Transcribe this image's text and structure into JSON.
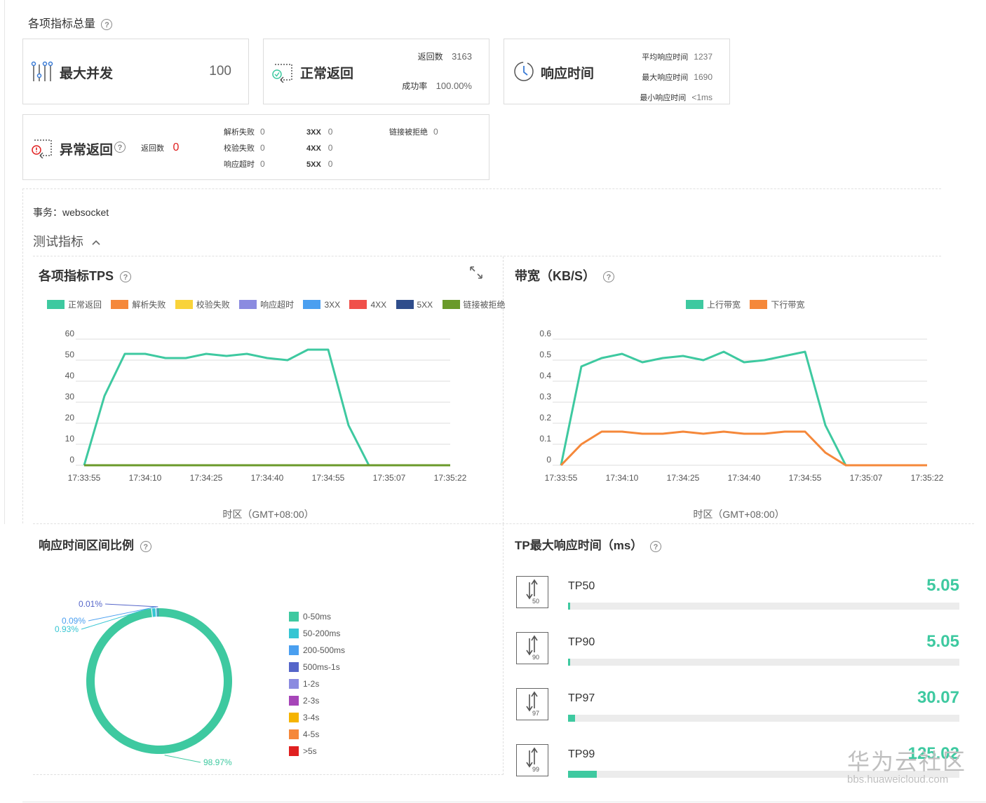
{
  "summary": {
    "title": "各项指标总量",
    "max_concurrency": {
      "title": "最大并发",
      "value": "100"
    },
    "normal_return": {
      "title": "正常返回",
      "return_count_label": "返回数",
      "return_count": "3163",
      "success_label": "成功率",
      "success_rate": "100.00%"
    },
    "response_time": {
      "title": "响应时间",
      "avg_label": "平均响应时间",
      "avg": "1237",
      "max_label": "最大响应时间",
      "max": "1690",
      "min_label": "最小响应时间",
      "min": "<1ms"
    },
    "abnormal_return": {
      "title": "异常返回",
      "return_count_label": "返回数",
      "return_count": "0",
      "parse_fail_label": "解析失败",
      "parse_fail": "0",
      "verify_fail_label": "校验失败",
      "verify_fail": "0",
      "timeout_label": "响应超时",
      "timeout": "0",
      "x3_label": "3XX",
      "x3": "0",
      "x4_label": "4XX",
      "x4": "0",
      "x5_label": "5XX",
      "x5": "0",
      "refused_label": "链接被拒绝",
      "refused": "0"
    }
  },
  "transaction": {
    "label": "事务：websocket"
  },
  "metrics_toggle": {
    "label": "测试指标"
  },
  "colors": {
    "accent": "#3ec9a0",
    "orange": "#f5883a",
    "error": "#e02020"
  },
  "tps_chart": {
    "title": "各项指标TPS",
    "timezone": "时区（GMT+08:00）",
    "legend": [
      {
        "name": "正常返回",
        "color": "#3ec9a0"
      },
      {
        "name": "解析失败",
        "color": "#f5883a"
      },
      {
        "name": "校验失败",
        "color": "#f9d33a"
      },
      {
        "name": "响应超时",
        "color": "#8b8be0"
      },
      {
        "name": "3XX",
        "color": "#4a9ff0"
      },
      {
        "name": "4XX",
        "color": "#f0504a"
      },
      {
        "name": "5XX",
        "color": "#2f4d8c"
      },
      {
        "name": "链接被拒绝",
        "color": "#6a9a2a"
      }
    ]
  },
  "bw_chart": {
    "title": "带宽（KB/S）",
    "timezone": "时区（GMT+08:00）",
    "legend": [
      {
        "name": "上行带宽",
        "color": "#3ec9a0"
      },
      {
        "name": "下行带宽",
        "color": "#f5883a"
      }
    ]
  },
  "chart_data": [
    {
      "type": "line",
      "title": "各项指标TPS",
      "xlabel": "时区（GMT+08:00）",
      "x_ticks": [
        "17:33:55",
        "17:34:10",
        "17:34:25",
        "17:34:40",
        "17:34:55",
        "17:35:07",
        "17:35:22"
      ],
      "y_ticks": [
        "60",
        "50",
        "40",
        "30",
        "20",
        "10",
        "0"
      ],
      "ylim": [
        0,
        60
      ],
      "grid": true,
      "legend_position": "top",
      "x_count": 19,
      "series": [
        {
          "name": "正常返回",
          "color": "#3ec9a0",
          "values": [
            0,
            33,
            53,
            53,
            51,
            51,
            53,
            52,
            53,
            51,
            50,
            55,
            55,
            19,
            0,
            0,
            0,
            0,
            0
          ]
        },
        {
          "name": "链接被拒绝",
          "color": "#6a9a2a",
          "values": [
            0,
            0,
            0,
            0,
            0,
            0,
            0,
            0,
            0,
            0,
            0,
            0,
            0,
            0,
            0,
            0,
            0,
            0,
            0
          ]
        }
      ]
    },
    {
      "type": "line",
      "title": "带宽（KB/S）",
      "xlabel": "时区（GMT+08:00）",
      "x_ticks": [
        "17:33:55",
        "17:34:10",
        "17:34:25",
        "17:34:40",
        "17:34:55",
        "17:35:07",
        "17:35:22"
      ],
      "y_ticks": [
        "0.6",
        "0.5",
        "0.4",
        "0.3",
        "0.2",
        "0.1",
        "0"
      ],
      "ylim": [
        0,
        0.6
      ],
      "grid": true,
      "legend_position": "top",
      "x_count": 19,
      "series": [
        {
          "name": "上行带宽",
          "color": "#3ec9a0",
          "values": [
            0,
            0.47,
            0.51,
            0.53,
            0.49,
            0.51,
            0.52,
            0.5,
            0.54,
            0.49,
            0.5,
            0.52,
            0.54,
            0.19,
            0,
            0,
            0,
            0,
            0
          ]
        },
        {
          "name": "下行带宽",
          "color": "#f5883a",
          "values": [
            0,
            0.1,
            0.16,
            0.16,
            0.15,
            0.15,
            0.16,
            0.15,
            0.16,
            0.15,
            0.15,
            0.16,
            0.16,
            0.06,
            0,
            0,
            0,
            0,
            0
          ]
        }
      ]
    },
    {
      "type": "pie",
      "title": "响应时间区间比例",
      "legend_position": "right",
      "categories": [
        "0-50ms",
        "50-200ms",
        "200-500ms",
        "500ms-1s",
        "1-2s",
        "2-3s",
        "3-4s",
        "4-5s",
        ">5s"
      ],
      "colors": [
        "#3ec9a0",
        "#36c6d3",
        "#4a9ff0",
        "#5565c9",
        "#8b8be0",
        "#a645b8",
        "#f5b400",
        "#f5883a",
        "#e02020"
      ],
      "values": [
        98.97,
        0.93,
        0.09,
        0.01,
        0,
        0,
        0,
        0,
        0
      ],
      "labels": [
        "98.97%",
        "0.93%",
        "0.09%",
        "0.01%"
      ]
    },
    {
      "type": "bar",
      "title": "TP最大响应时间（ms）",
      "categories": [
        "TP50",
        "TP90",
        "TP97",
        "TP99"
      ],
      "icon_numbers": [
        "50",
        "90",
        "97",
        "99"
      ],
      "values": [
        5.05,
        5.05,
        30.07,
        125.02
      ],
      "value_labels": [
        "5.05",
        "5.05",
        "30.07",
        "125.02"
      ],
      "max": 1690
    }
  ],
  "pie_title": "响应时间区间比例",
  "tp_title": "TP最大响应时间（ms）",
  "watermark": {
    "text": "华为云社区",
    "url": "bbs.huaweicloud.com"
  }
}
